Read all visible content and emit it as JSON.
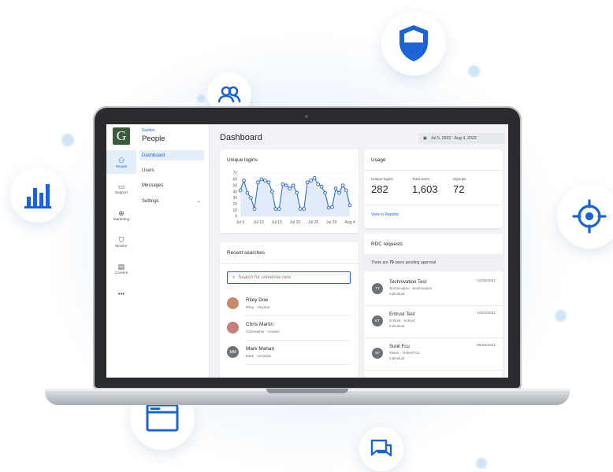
{
  "app": {
    "logo_letter": "G",
    "context": "Garden",
    "section": "People"
  },
  "rail": [
    {
      "label": "People",
      "icon": "people-icon",
      "active": true
    },
    {
      "label": "Support",
      "icon": "chat-icon",
      "active": false
    },
    {
      "label": "Marketing",
      "icon": "target-icon",
      "active": false
    },
    {
      "label": "Monitor",
      "icon": "shield-icon",
      "active": false
    },
    {
      "label": "Content",
      "icon": "window-icon",
      "active": false
    },
    {
      "label": "•••",
      "icon": "more-icon",
      "active": false
    }
  ],
  "subnav": [
    {
      "label": "Dashboard",
      "active": true
    },
    {
      "label": "Users"
    },
    {
      "label": "Messages"
    },
    {
      "label": "Settings",
      "chevron": "⌄"
    }
  ],
  "header": {
    "title": "Dashboard",
    "date_range": "Jul 5, 2023 - Aug 4, 2023"
  },
  "unique_logins": {
    "title": "Unique logins"
  },
  "chart_data": {
    "type": "line",
    "title": "Unique logins",
    "yticks": [
      "70",
      "60",
      "50",
      "40",
      "30",
      "20",
      "10",
      "0"
    ],
    "ylim": [
      0,
      70
    ],
    "xticks": [
      "Jul 5",
      "Jul 10",
      "Jul 15",
      "Jul 20",
      "Jul 25",
      "Jul 30",
      "Aug 4"
    ],
    "series": [
      {
        "values": [
          42,
          58,
          38,
          30,
          12,
          55,
          60,
          58,
          55,
          40,
          12,
          12,
          52,
          50,
          45,
          50,
          38,
          12,
          12,
          55,
          58,
          62,
          52,
          48,
          38,
          14,
          15,
          45,
          38,
          50,
          42,
          18
        ]
      }
    ],
    "grid": true,
    "line_color": "#1c63d6",
    "fill_color": "#d9e6fa"
  },
  "usage": {
    "title": "Usage",
    "stats": [
      {
        "label": "Unique logins",
        "value": "282"
      },
      {
        "label": "Total users",
        "value": "1,603"
      },
      {
        "label": "Signups",
        "value": "72"
      }
    ],
    "link": "View in Reports"
  },
  "recent": {
    "title": "Recent searches",
    "placeholder": "Search for someone new",
    "people": [
      {
        "name": "Riley Doe",
        "sub": "Riley · rileydoe",
        "initials": "",
        "color": "#c98a6a"
      },
      {
        "name": "Chris Martin",
        "sub": "Christopher · cmartin",
        "initials": "",
        "color": "#c47f7a"
      },
      {
        "name": "Mark Mahan",
        "sub": "Mark · mmahan",
        "initials": "MM",
        "color": "#6d7178"
      }
    ]
  },
  "rdc": {
    "title": "RDC requests",
    "banner_pre": "There are ",
    "banner_count": "79",
    "banner_post": " users pending approval",
    "requests": [
      {
        "initials": "TT",
        "name": "Technivation Test",
        "sub": "Technivation · technivation",
        "type": "Individual",
        "date": "12/28/2021"
      },
      {
        "initials": "ET",
        "name": "Entrust Test",
        "sub": "Entrust · entrust",
        "type": "Individual",
        "date": "12/03/2021"
      },
      {
        "initials": "SF",
        "name": "Sunil Fcu",
        "sub": "Tinker · TinkerFCU",
        "type": "Individual",
        "date": "05/25/2021"
      }
    ]
  },
  "floating_icons": [
    "people-icon",
    "shield-icon",
    "bar-chart-icon",
    "target-icon",
    "window-icon",
    "chat-icon"
  ],
  "accent": "#1c63d6"
}
